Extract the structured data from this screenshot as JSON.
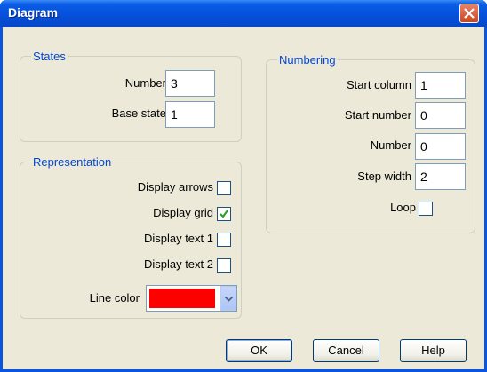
{
  "window": {
    "title": "Diagram"
  },
  "states": {
    "legend": "States",
    "number_label": "Number",
    "number_value": "3",
    "base_state_label": "Base state",
    "base_state_value": "1"
  },
  "representation": {
    "legend": "Representation",
    "display_arrows_label": "Display arrows",
    "display_arrows_checked": false,
    "display_grid_label": "Display grid",
    "display_grid_checked": true,
    "display_text1_label": "Display text 1",
    "display_text1_checked": false,
    "display_text2_label": "Display text 2",
    "display_text2_checked": false,
    "line_color_label": "Line color",
    "line_color_value": "#ff0000"
  },
  "numbering": {
    "legend": "Numbering",
    "start_column_label": "Start column",
    "start_column_value": "1",
    "start_number_label": "Start number",
    "start_number_value": "0",
    "number_label": "Number",
    "number_value": "0",
    "step_width_label": "Step width",
    "step_width_value": "2",
    "loop_label": "Loop",
    "loop_checked": false
  },
  "buttons": {
    "ok": "OK",
    "cancel": "Cancel",
    "help": "Help"
  },
  "colors": {
    "titlebar": "#0a54e0",
    "dialog_bg": "#ece9d8",
    "group_legend": "#0046d5",
    "check_mark": "#21a121"
  }
}
